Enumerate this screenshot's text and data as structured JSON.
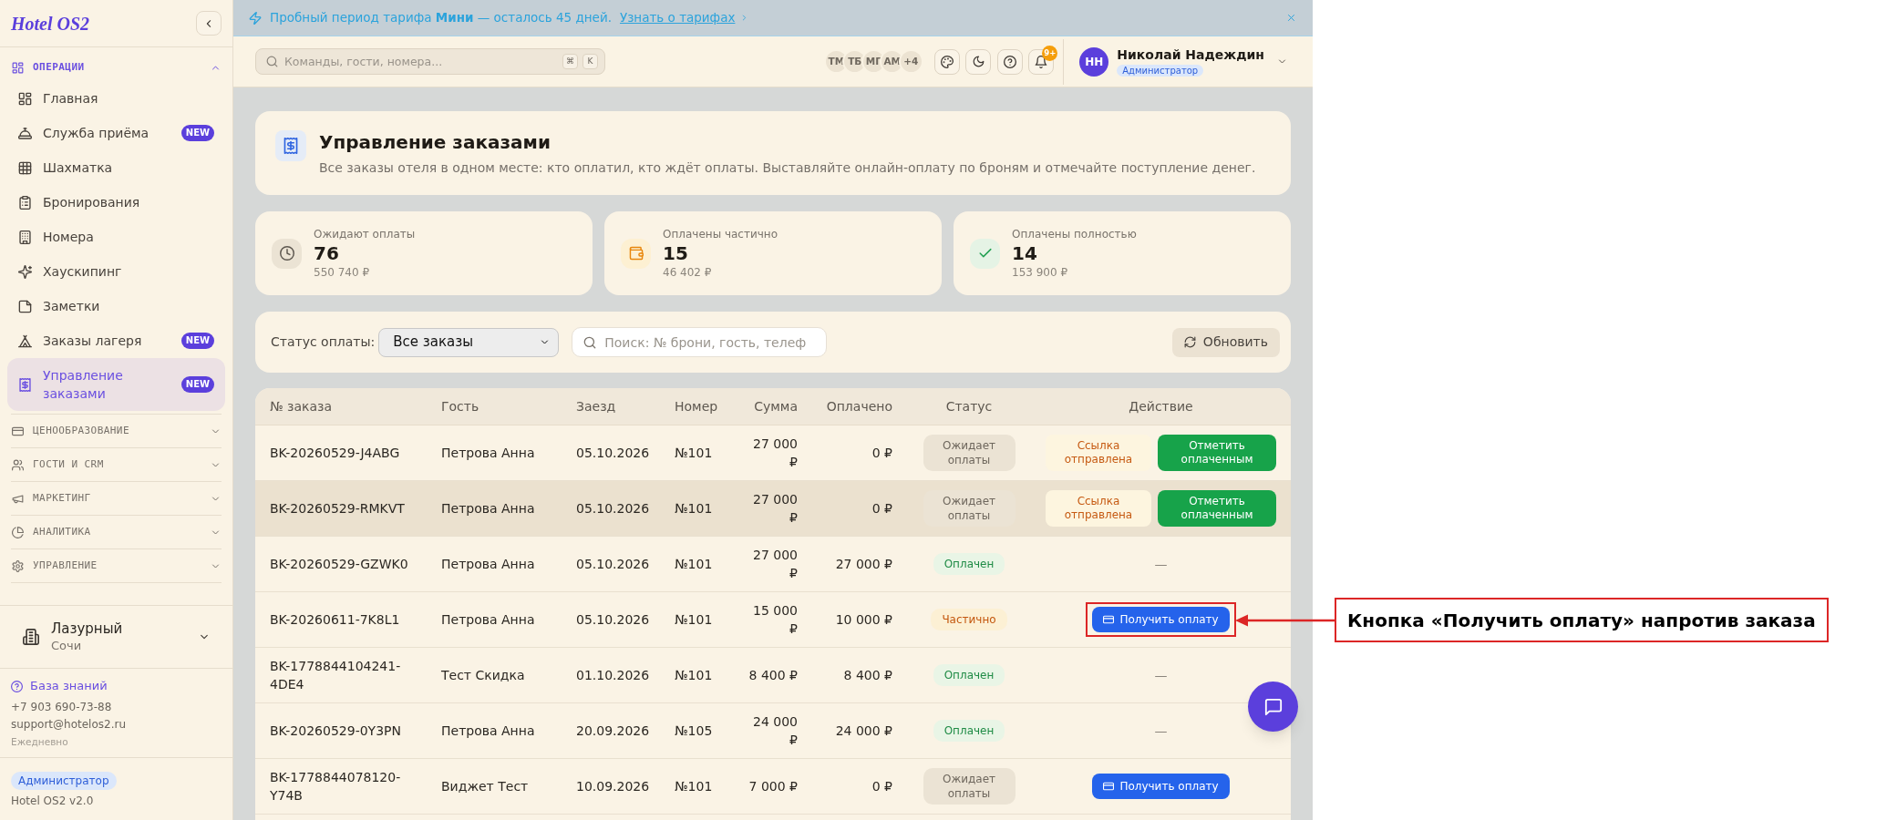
{
  "banner": {
    "text": "Пробный период тарифа **Мини** — осталось 45 дней.",
    "link": "Узнать о тарифах"
  },
  "sidebar": {
    "logo": "Hotel OS2",
    "sections": [
      {
        "label": "ОПЕРАЦИИ",
        "expanded": true,
        "items": [
          {
            "label": "Главная",
            "selected": false
          },
          {
            "label": "Служба приёма",
            "badge": "NEW",
            "selected": false
          },
          {
            "label": "Шахматка",
            "selected": false
          },
          {
            "label": "Бронирования",
            "selected": false
          },
          {
            "label": "Номера",
            "selected": false
          },
          {
            "label": "Хаускипинг",
            "selected": false
          },
          {
            "label": "Заметки",
            "selected": false
          },
          {
            "label": "Заказы лагеря",
            "badge": "NEW",
            "selected": false
          },
          {
            "label": "Управление заказами",
            "badge": "NEW",
            "selected": true
          }
        ]
      },
      {
        "label": "ЦЕНООБРАЗОВАНИЕ",
        "expanded": false
      },
      {
        "label": "ГОСТИ И CRM",
        "expanded": false
      },
      {
        "label": "МАРКЕТИНГ",
        "expanded": false
      },
      {
        "label": "АНАЛИТИКА",
        "expanded": false
      },
      {
        "label": "УПРАВЛЕНИЕ",
        "expanded": false
      }
    ],
    "hotel": {
      "name": "Лазурный",
      "city": "Сочи"
    },
    "support": {
      "link": "База знаний",
      "phone": "+7 903 690-73-88",
      "email": "support@hotelos2.ru",
      "hours": "Ежедневно"
    },
    "role": "Администратор",
    "version": "Hotel OS2 v2.0"
  },
  "header": {
    "search": {
      "placeholder": "Команды, гости, номера...",
      "keys": [
        "⌘",
        "K"
      ]
    },
    "team": [
      "ТМ",
      "ТБ",
      "МГ",
      "АМ"
    ],
    "team_more": "+4",
    "notifications": "9+",
    "user": {
      "initials": "НН",
      "name": "Николай Надеждин",
      "role": "Администратор"
    }
  },
  "page": {
    "title": "Управление заказами",
    "description": "Все заказы отеля в одном месте: кто оплатил, кто ждёт оплаты. Выставляйте онлайн-оплату по броням и отмечайте поступление денег."
  },
  "stats": [
    {
      "kind": "pending",
      "label": "Ожидают оплаты",
      "value": "76",
      "sum": "550 740 ₽"
    },
    {
      "kind": "partial",
      "label": "Оплачены частично",
      "value": "15",
      "sum": "46 402 ₽"
    },
    {
      "kind": "paid",
      "label": "Оплачены полностью",
      "value": "14",
      "sum": "153 900 ₽"
    }
  ],
  "filters": {
    "label": "Статус оплаты:",
    "status": "Все заказы",
    "search_placeholder": "Поиск: № брони, гость, телеф",
    "refresh": "Обновить"
  },
  "table": {
    "columns": [
      "№ заказа",
      "Гость",
      "Заезд",
      "Номер",
      "Сумма",
      "Оплачено",
      "Статус",
      "Действие"
    ],
    "rows": [
      {
        "order": "BK-20260529-J4ABG",
        "guest": "Петрова Анна",
        "checkin": "05.10.2026",
        "room": "№101",
        "sum": "27 000 ₽",
        "paid": "0 ₽",
        "status": {
          "kind": "pending",
          "label": "Ожидает оплаты"
        },
        "highlighted": false,
        "actions": [
          {
            "kind": "link_sent",
            "label": "Ссылка отправлена",
            "annotated": false
          },
          {
            "kind": "mark_paid",
            "label": "Отметить оплаченным",
            "annotated": false
          }
        ]
      },
      {
        "order": "BK-20260529-RMKVT",
        "guest": "Петрова Анна",
        "checkin": "05.10.2026",
        "room": "№101",
        "sum": "27 000 ₽",
        "paid": "0 ₽",
        "status": {
          "kind": "pending",
          "label": "Ожидает оплаты"
        },
        "highlighted": true,
        "actions": [
          {
            "kind": "link_sent",
            "label": "Ссылка отправлена",
            "annotated": false
          },
          {
            "kind": "mark_paid",
            "label": "Отметить оплаченным",
            "annotated": false
          }
        ]
      },
      {
        "order": "BK-20260529-GZWK0",
        "guest": "Петрова Анна",
        "checkin": "05.10.2026",
        "room": "№101",
        "sum": "27 000 ₽",
        "paid": "27 000 ₽",
        "status": {
          "kind": "paid",
          "label": "Оплачен"
        },
        "highlighted": false,
        "actions": [
          {
            "kind": "none",
            "label": "—",
            "annotated": false
          }
        ]
      },
      {
        "order": "BK-20260611-7K8L1",
        "guest": "Петрова Анна",
        "checkin": "05.10.2026",
        "room": "№101",
        "sum": "15 000 ₽",
        "paid": "10 000 ₽",
        "status": {
          "kind": "partial",
          "label": "Частично"
        },
        "highlighted": false,
        "actions": [
          {
            "kind": "get_payment",
            "label": "Получить оплату",
            "annotated": true
          }
        ]
      },
      {
        "order": "BK-1778844104241-4DE4",
        "guest": "Тест Скидка",
        "checkin": "01.10.2026",
        "room": "№101",
        "sum": "8 400 ₽",
        "paid": "8 400 ₽",
        "status": {
          "kind": "paid",
          "label": "Оплачен"
        },
        "highlighted": false,
        "actions": [
          {
            "kind": "none",
            "label": "—",
            "annotated": false
          }
        ]
      },
      {
        "order": "BK-20260529-0Y3PN",
        "guest": "Петрова Анна",
        "checkin": "20.09.2026",
        "room": "№105",
        "sum": "24 000 ₽",
        "paid": "24 000 ₽",
        "status": {
          "kind": "paid",
          "label": "Оплачен"
        },
        "highlighted": false,
        "actions": [
          {
            "kind": "none",
            "label": "—",
            "annotated": false
          }
        ]
      },
      {
        "order": "BK-1778844078120-Y74B",
        "guest": "Виджет Тест",
        "checkin": "10.09.2026",
        "room": "№101",
        "sum": "7 000 ₽",
        "paid": "0 ₽",
        "status": {
          "kind": "pending",
          "label": "Ожидает оплаты"
        },
        "highlighted": false,
        "actions": [
          {
            "kind": "get_payment",
            "label": "Получить оплату",
            "annotated": false
          }
        ]
      }
    ]
  },
  "annotation": {
    "text": "Кнопка «Получить оплату» напротив заказа"
  }
}
